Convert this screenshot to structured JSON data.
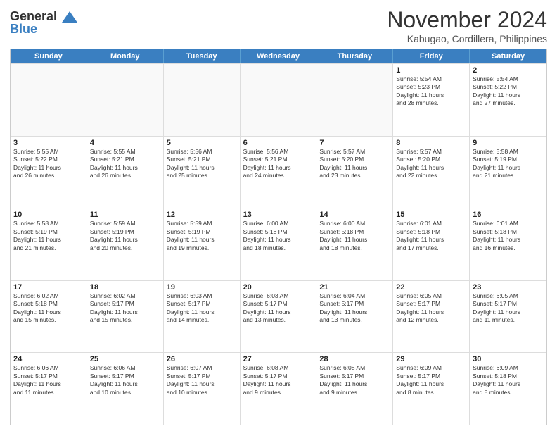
{
  "header": {
    "logo_line1": "General",
    "logo_line2": "Blue",
    "month_title": "November 2024",
    "location": "Kabugao, Cordillera, Philippines"
  },
  "weekdays": [
    "Sunday",
    "Monday",
    "Tuesday",
    "Wednesday",
    "Thursday",
    "Friday",
    "Saturday"
  ],
  "rows": [
    [
      {
        "day": "",
        "detail": "",
        "empty": true
      },
      {
        "day": "",
        "detail": "",
        "empty": true
      },
      {
        "day": "",
        "detail": "",
        "empty": true
      },
      {
        "day": "",
        "detail": "",
        "empty": true
      },
      {
        "day": "",
        "detail": "",
        "empty": true
      },
      {
        "day": "1",
        "detail": "Sunrise: 5:54 AM\nSunset: 5:23 PM\nDaylight: 11 hours\nand 28 minutes.",
        "empty": false
      },
      {
        "day": "2",
        "detail": "Sunrise: 5:54 AM\nSunset: 5:22 PM\nDaylight: 11 hours\nand 27 minutes.",
        "empty": false
      }
    ],
    [
      {
        "day": "3",
        "detail": "Sunrise: 5:55 AM\nSunset: 5:22 PM\nDaylight: 11 hours\nand 26 minutes.",
        "empty": false
      },
      {
        "day": "4",
        "detail": "Sunrise: 5:55 AM\nSunset: 5:21 PM\nDaylight: 11 hours\nand 26 minutes.",
        "empty": false
      },
      {
        "day": "5",
        "detail": "Sunrise: 5:56 AM\nSunset: 5:21 PM\nDaylight: 11 hours\nand 25 minutes.",
        "empty": false
      },
      {
        "day": "6",
        "detail": "Sunrise: 5:56 AM\nSunset: 5:21 PM\nDaylight: 11 hours\nand 24 minutes.",
        "empty": false
      },
      {
        "day": "7",
        "detail": "Sunrise: 5:57 AM\nSunset: 5:20 PM\nDaylight: 11 hours\nand 23 minutes.",
        "empty": false
      },
      {
        "day": "8",
        "detail": "Sunrise: 5:57 AM\nSunset: 5:20 PM\nDaylight: 11 hours\nand 22 minutes.",
        "empty": false
      },
      {
        "day": "9",
        "detail": "Sunrise: 5:58 AM\nSunset: 5:19 PM\nDaylight: 11 hours\nand 21 minutes.",
        "empty": false
      }
    ],
    [
      {
        "day": "10",
        "detail": "Sunrise: 5:58 AM\nSunset: 5:19 PM\nDaylight: 11 hours\nand 21 minutes.",
        "empty": false
      },
      {
        "day": "11",
        "detail": "Sunrise: 5:59 AM\nSunset: 5:19 PM\nDaylight: 11 hours\nand 20 minutes.",
        "empty": false
      },
      {
        "day": "12",
        "detail": "Sunrise: 5:59 AM\nSunset: 5:19 PM\nDaylight: 11 hours\nand 19 minutes.",
        "empty": false
      },
      {
        "day": "13",
        "detail": "Sunrise: 6:00 AM\nSunset: 5:18 PM\nDaylight: 11 hours\nand 18 minutes.",
        "empty": false
      },
      {
        "day": "14",
        "detail": "Sunrise: 6:00 AM\nSunset: 5:18 PM\nDaylight: 11 hours\nand 18 minutes.",
        "empty": false
      },
      {
        "day": "15",
        "detail": "Sunrise: 6:01 AM\nSunset: 5:18 PM\nDaylight: 11 hours\nand 17 minutes.",
        "empty": false
      },
      {
        "day": "16",
        "detail": "Sunrise: 6:01 AM\nSunset: 5:18 PM\nDaylight: 11 hours\nand 16 minutes.",
        "empty": false
      }
    ],
    [
      {
        "day": "17",
        "detail": "Sunrise: 6:02 AM\nSunset: 5:18 PM\nDaylight: 11 hours\nand 15 minutes.",
        "empty": false
      },
      {
        "day": "18",
        "detail": "Sunrise: 6:02 AM\nSunset: 5:17 PM\nDaylight: 11 hours\nand 15 minutes.",
        "empty": false
      },
      {
        "day": "19",
        "detail": "Sunrise: 6:03 AM\nSunset: 5:17 PM\nDaylight: 11 hours\nand 14 minutes.",
        "empty": false
      },
      {
        "day": "20",
        "detail": "Sunrise: 6:03 AM\nSunset: 5:17 PM\nDaylight: 11 hours\nand 13 minutes.",
        "empty": false
      },
      {
        "day": "21",
        "detail": "Sunrise: 6:04 AM\nSunset: 5:17 PM\nDaylight: 11 hours\nand 13 minutes.",
        "empty": false
      },
      {
        "day": "22",
        "detail": "Sunrise: 6:05 AM\nSunset: 5:17 PM\nDaylight: 11 hours\nand 12 minutes.",
        "empty": false
      },
      {
        "day": "23",
        "detail": "Sunrise: 6:05 AM\nSunset: 5:17 PM\nDaylight: 11 hours\nand 11 minutes.",
        "empty": false
      }
    ],
    [
      {
        "day": "24",
        "detail": "Sunrise: 6:06 AM\nSunset: 5:17 PM\nDaylight: 11 hours\nand 11 minutes.",
        "empty": false
      },
      {
        "day": "25",
        "detail": "Sunrise: 6:06 AM\nSunset: 5:17 PM\nDaylight: 11 hours\nand 10 minutes.",
        "empty": false
      },
      {
        "day": "26",
        "detail": "Sunrise: 6:07 AM\nSunset: 5:17 PM\nDaylight: 11 hours\nand 10 minutes.",
        "empty": false
      },
      {
        "day": "27",
        "detail": "Sunrise: 6:08 AM\nSunset: 5:17 PM\nDaylight: 11 hours\nand 9 minutes.",
        "empty": false
      },
      {
        "day": "28",
        "detail": "Sunrise: 6:08 AM\nSunset: 5:17 PM\nDaylight: 11 hours\nand 9 minutes.",
        "empty": false
      },
      {
        "day": "29",
        "detail": "Sunrise: 6:09 AM\nSunset: 5:17 PM\nDaylight: 11 hours\nand 8 minutes.",
        "empty": false
      },
      {
        "day": "30",
        "detail": "Sunrise: 6:09 AM\nSunset: 5:18 PM\nDaylight: 11 hours\nand 8 minutes.",
        "empty": false
      }
    ]
  ]
}
